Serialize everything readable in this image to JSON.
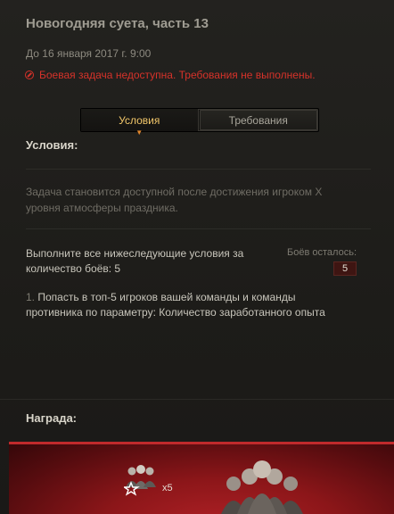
{
  "header": {
    "title": "Новогодняя суета, часть 13",
    "deadline": "До 16 января 2017 г. 9:00",
    "alert": "Боевая задача недоступна. Требования не выполнены."
  },
  "tabs": [
    {
      "label": "Условия",
      "active": true
    },
    {
      "label": "Требования",
      "active": false
    }
  ],
  "conditions": {
    "heading": "Условия:",
    "description": "Задача становится доступной после достижения игроком X уровня атмосферы праздника.",
    "intro": "Выполните все нижеследующие условия за количество боёв: 5",
    "battles_left_label": "Боёв осталось:",
    "battles_left_value": "5",
    "item_number": "1.",
    "item_text": "Попасть в топ-5 игроков вашей команды и команды противника по параметру: Количество заработанного опыта"
  },
  "reward": {
    "heading": "Награда:",
    "crew_multiplier": "x5",
    "icons": [
      "crew-group-icon",
      "star-outline-icon",
      "crew-portrait-icon"
    ]
  },
  "colors": {
    "alert": "#d6322a",
    "active_tab_text": "#f2c76a",
    "reward_band": "#8c1619"
  }
}
